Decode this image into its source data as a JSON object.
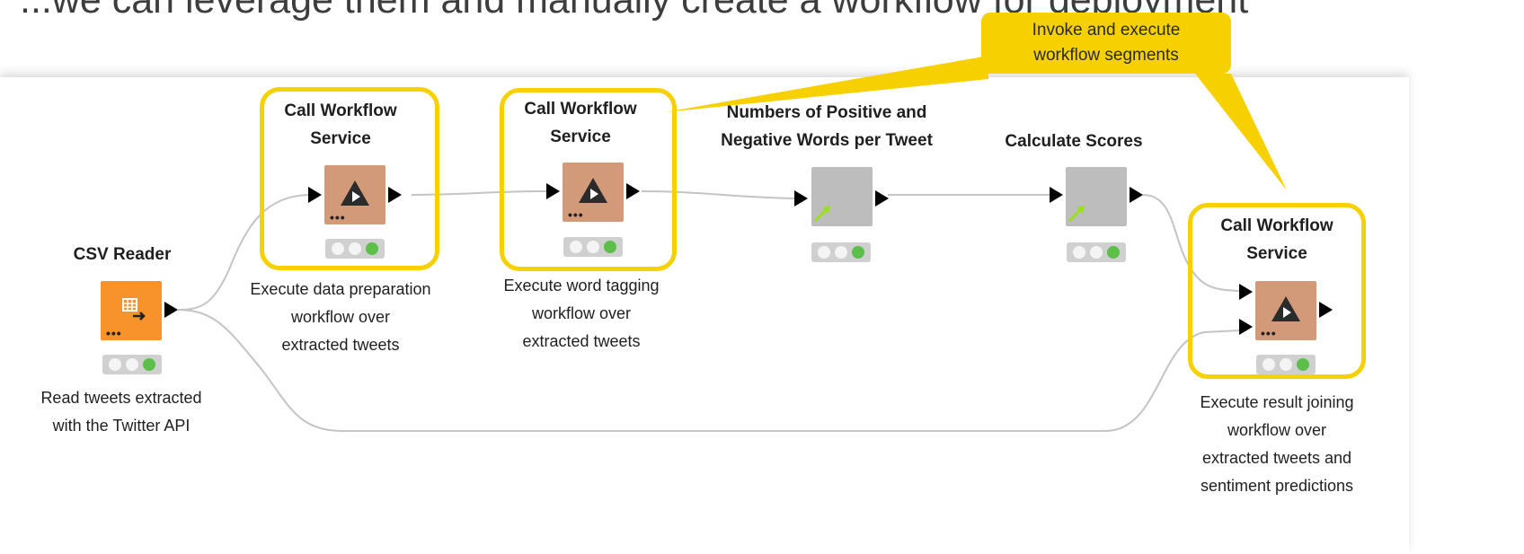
{
  "slide_title": "...we can leverage them and manually create a workflow for deployment",
  "callout": {
    "lines": [
      "Invoke and execute",
      "workflow segments"
    ],
    "color": "#f7d000"
  },
  "nodes": [
    {
      "id": "csv-reader",
      "title_lines": [
        "CSV Reader"
      ],
      "desc_lines": [
        "Read tweets extracted",
        "with the Twitter API"
      ],
      "icon": "table-export-icon",
      "color": "#f7932a"
    },
    {
      "id": "call-workflow-1",
      "title_lines": [
        "Call Workflow",
        "Service"
      ],
      "desc_lines": [
        "Execute data preparation",
        "workflow over",
        "extracted tweets"
      ],
      "icon": "workflow-service-icon",
      "color": "#d39a7a"
    },
    {
      "id": "call-workflow-2",
      "title_lines": [
        "Call Workflow",
        "Service"
      ],
      "desc_lines": [
        "Execute word tagging",
        "workflow over",
        "extracted tweets"
      ],
      "icon": "workflow-service-icon",
      "color": "#d39a7a"
    },
    {
      "id": "numbers-pos-neg",
      "title_lines": [
        "Numbers of Positive and",
        "Negative Words per Tweet"
      ],
      "desc_lines": [],
      "icon": "metanode-arrow-icon",
      "color": "#bdbdbd"
    },
    {
      "id": "calculate-scores",
      "title_lines": [
        "Calculate Scores"
      ],
      "desc_lines": [],
      "icon": "metanode-arrow-icon",
      "color": "#bdbdbd"
    },
    {
      "id": "call-workflow-3",
      "title_lines": [
        "Call Workflow",
        "Service"
      ],
      "desc_lines": [
        "Execute result joining",
        "workflow over",
        "extracted tweets and",
        "sentiment predictions"
      ],
      "icon": "workflow-service-icon",
      "color": "#d39a7a"
    }
  ],
  "highlight_color": "#f7d000",
  "status_colors": {
    "inactive": "#f4f4f4",
    "executed": "#5bbf4a"
  }
}
